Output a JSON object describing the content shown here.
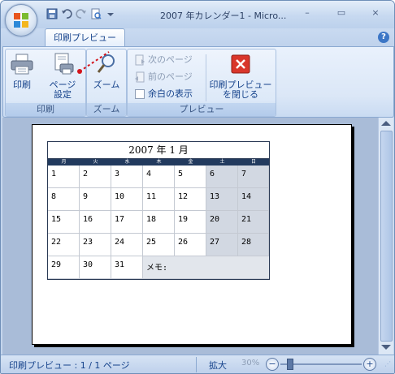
{
  "window": {
    "title": "2007 年カレンダー1 - Micro...",
    "controls": {
      "minimize": "–",
      "maximize": "▭",
      "close": "×"
    }
  },
  "qat": {
    "icons": [
      "save-icon",
      "undo-icon",
      "redo-icon",
      "print-preview-icon",
      "customize-icon"
    ]
  },
  "ribbon": {
    "tab": "印刷プレビュー",
    "help": "?",
    "groups": {
      "print": {
        "label": "印刷",
        "print_button": "印刷",
        "page_setup_line1": "ページ",
        "page_setup_line2": "設定"
      },
      "zoom": {
        "label": "ズーム",
        "zoom_button": "ズーム"
      },
      "preview": {
        "label": "プレビュー",
        "next_page": "次のページ",
        "prev_page": "前のページ",
        "show_margins": "余白の表示",
        "close_line1": "印刷プレビュー",
        "close_line2": "を閉じる"
      }
    }
  },
  "calendar": {
    "title": "2007 年 1 月",
    "day_headers": [
      "月",
      "火",
      "水",
      "木",
      "金",
      "土",
      "日"
    ],
    "weeks": [
      [
        "1",
        "2",
        "3",
        "4",
        "5",
        "6",
        "7"
      ],
      [
        "8",
        "9",
        "10",
        "11",
        "12",
        "13",
        "14"
      ],
      [
        "15",
        "16",
        "17",
        "18",
        "19",
        "20",
        "21"
      ],
      [
        "22",
        "23",
        "24",
        "25",
        "26",
        "27",
        "28"
      ]
    ],
    "last_week": [
      "29",
      "30",
      "31"
    ],
    "memo_label": "メモ:"
  },
  "status": {
    "page_info": "印刷プレビュー : 1 / 1 ページ",
    "zoom_label": "拡大",
    "zoom_percent": "30%",
    "zoom_level": 0.3
  },
  "colors": {
    "accent": "#15428b",
    "ribbon_bg": "#dbe7f7",
    "preview_bg": "#a9bcd8",
    "calendar_header": "#223a5e",
    "weekend_cell": "#d2d8e2",
    "close_button_red": "#d9362b"
  }
}
